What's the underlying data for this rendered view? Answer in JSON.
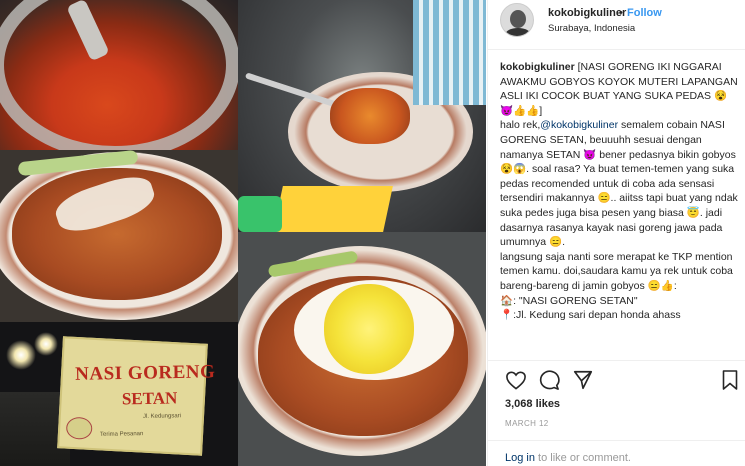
{
  "post": {
    "username": "kokobigkuliner",
    "separator": "•",
    "follow_label": "Follow",
    "location": "Surabaya, Indonesia"
  },
  "caption": {
    "lines": [
      {
        "user": "kokobigkuliner",
        "text": " [NASI GORENG IKI NGGARAI AWAKMU GOBYOS KOYOK MUTERI LAPANGAN ASLI IKI COCOK BUAT YANG SUKA PEDAS 😵😈👍👍]"
      },
      {
        "pre": "halo rek,",
        "mention": "@kokobigkuliner",
        "text": " semalem cobain NASI GORENG SETAN, beuuuhh sesuai dengan namanya SETAN 😈 bener pedasnya bikin gobyos 😵😱. soal rasa? Ya buat temen-temen yang suka pedas recomended untuk di coba ada sensasi tersendiri makannya 😑.. aiitss tapi buat yang ndak suka pedes juga bisa pesen yang biasa 😇. jadi dasarnya rasanya kayak nasi goreng jawa pada umumnya 😑."
      },
      {
        "text": "langsung saja nanti sore merapat ke TKP mention temen kamu. doi,saudara kamu ya rek untuk coba bareng-bareng di jamin gobyos 😑👍:"
      },
      {
        "text": "🏠: \"NASI GORENG SETAN\""
      },
      {
        "text": "📍:Jl. Kedung sari depan honda ahass"
      }
    ]
  },
  "photo_banner": {
    "title": "NASI GORENG",
    "subtitle": "SETAN",
    "address": "Jl. Kedungsari",
    "note": "Terima Pesanan"
  },
  "actions": {
    "like_icon": "heart-icon",
    "comment_icon": "comment-icon",
    "share_icon": "share-icon",
    "save_icon": "bookmark-icon"
  },
  "stats": {
    "likes": "3,068 likes",
    "date": "MARCH 12"
  },
  "footer": {
    "login_link": "Log in",
    "login_text": " to like or comment."
  },
  "colors": {
    "accent": "#3897f0",
    "link": "#003569",
    "muted": "#999999"
  }
}
